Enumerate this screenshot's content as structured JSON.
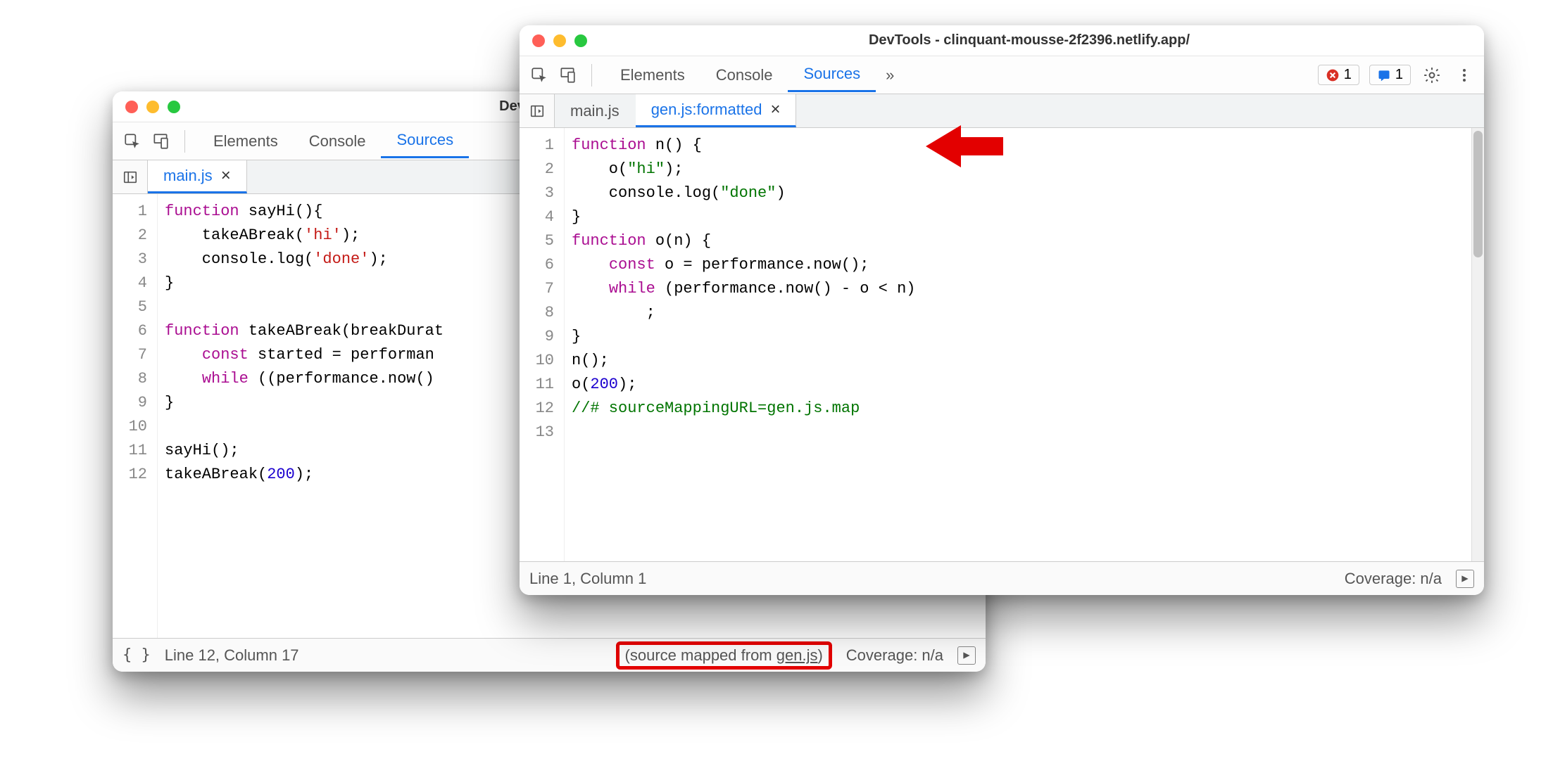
{
  "windowA": {
    "title": "DevTools - clinquant-m",
    "panels": [
      "Elements",
      "Console",
      "Sources"
    ],
    "activePanel": 2,
    "fileTabs": [
      {
        "label": "main.js",
        "active": true,
        "closable": true
      }
    ],
    "code": [
      {
        "n": "1",
        "html": "<span class='kw'>function</span> sayHi(){"
      },
      {
        "n": "2",
        "html": "    takeABreak(<span class='str'>'hi'</span>);"
      },
      {
        "n": "3",
        "html": "    console.log(<span class='str'>'done'</span>);"
      },
      {
        "n": "4",
        "html": "}"
      },
      {
        "n": "5",
        "html": ""
      },
      {
        "n": "6",
        "html": "<span class='kw'>function</span> takeABreak(breakDurat"
      },
      {
        "n": "7",
        "html": "    <span class='kw'>const</span> started = performan"
      },
      {
        "n": "8",
        "html": "    <span class='kw'>while</span> ((performance.now()"
      },
      {
        "n": "9",
        "html": "}"
      },
      {
        "n": "10",
        "html": ""
      },
      {
        "n": "11",
        "html": "sayHi();"
      },
      {
        "n": "12",
        "html": "takeABreak(<span class='num'>200</span>);"
      }
    ],
    "status": {
      "pretty": "{ }",
      "position": "Line 12, Column 17",
      "mappedPrefix": "(source mapped from ",
      "mappedLink": "gen.js",
      "mappedSuffix": ")",
      "coverage": "Coverage: n/a"
    }
  },
  "windowB": {
    "title": "DevTools - clinquant-mousse-2f2396.netlify.app/",
    "panels": [
      "Elements",
      "Console",
      "Sources"
    ],
    "activePanel": 2,
    "more": "»",
    "errorCount": "1",
    "issueCount": "1",
    "fileTabs": [
      {
        "label": "main.js",
        "active": false,
        "closable": false
      },
      {
        "label": "gen.js:formatted",
        "active": true,
        "closable": true
      }
    ],
    "code": [
      {
        "n": "1",
        "html": "<span class='kw'>function</span> n() {"
      },
      {
        "n": "2",
        "html": "    o(<span class='strg'>\"hi\"</span>);"
      },
      {
        "n": "3",
        "html": "    console.log(<span class='strg'>\"done\"</span>)"
      },
      {
        "n": "4",
        "html": "}"
      },
      {
        "n": "5",
        "html": "<span class='kw'>function</span> o(n) {"
      },
      {
        "n": "6",
        "html": "    <span class='kw'>const</span> o = performance.now();"
      },
      {
        "n": "7",
        "html": "    <span class='kw'>while</span> (performance.now() - o &lt; n)"
      },
      {
        "n": "8",
        "html": "        ;"
      },
      {
        "n": "9",
        "html": "}"
      },
      {
        "n": "10",
        "html": "n();"
      },
      {
        "n": "11",
        "html": "o(<span class='num'>200</span>);"
      },
      {
        "n": "12",
        "html": "<span class='cmt'>//# sourceMappingURL=gen.js.map</span>"
      },
      {
        "n": "13",
        "html": ""
      }
    ],
    "status": {
      "position": "Line 1, Column 1",
      "coverage": "Coverage: n/a"
    }
  }
}
